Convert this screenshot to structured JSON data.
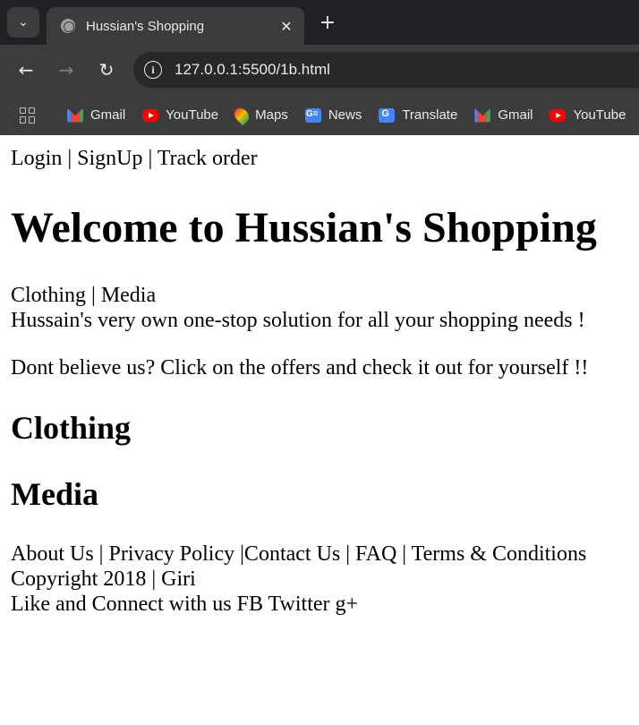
{
  "browser": {
    "tab_title": "Hussian's Shopping",
    "close_glyph": "✕",
    "new_tab_glyph": "+",
    "tab_search_glyph": "⌄",
    "back_glyph": "←",
    "forward_glyph": "→",
    "reload_glyph": "↻",
    "info_glyph": "i",
    "url": "127.0.0.1:5500/1b.html",
    "bookmarks": [
      "Gmail",
      "YouTube",
      "Maps",
      "News",
      "Translate",
      "Gmail",
      "YouTube"
    ]
  },
  "page": {
    "top_links": "Login | SignUp | Track order",
    "heading": "Welcome to Hussian's Shopping",
    "category_links": "Clothing | Media",
    "tagline": "Hussain's very own one-stop solution for all your shopping needs !",
    "offer_text": "Dont believe us? Click on the offers and check it out for yourself !!",
    "section_clothing": "Clothing",
    "section_media": "Media",
    "footer_links": "About Us | Privacy Policy |Contact Us | FAQ | Terms & Conditions",
    "copyright": "Copyright 2018 | Giri",
    "social": "Like and Connect with us FB Twitter g+"
  }
}
